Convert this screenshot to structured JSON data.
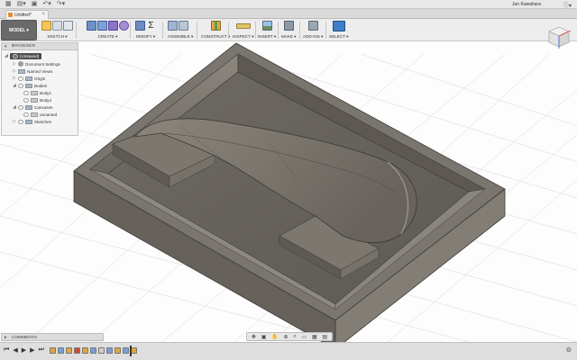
{
  "app": {
    "user_name": "Jun Kawahara",
    "help_icon": "help-icon",
    "menu_icons": [
      "grid-menu-icon",
      "file-icon",
      "save-icon",
      "undo-icon",
      "redo-icon"
    ]
  },
  "document": {
    "tab_title": "Untitled*"
  },
  "toolbar": {
    "workspace_label": "MODEL ▾",
    "groups": [
      {
        "label": "SKETCH ▾",
        "icons": [
          "sketch-icon",
          "line-icon",
          "rectangle-icon"
        ]
      },
      {
        "label": "CREATE ▾",
        "icons": [
          "box-icon",
          "extrude-icon",
          "revolve-icon",
          "sphere-icon"
        ]
      },
      {
        "label": "MODIFY ▾",
        "icons": [
          "press-pull-icon",
          "fillet-icon"
        ]
      },
      {
        "label": "ASSEMBLE ▾",
        "icons": [
          "component-icon",
          "joint-icon"
        ]
      },
      {
        "label": "CONSTRUCT ▾",
        "icons": [
          "plane-icon"
        ]
      },
      {
        "label": "INSPECT ▾",
        "icons": [
          "measure-icon"
        ]
      },
      {
        "label": "INSERT ▾",
        "icons": [
          "image-icon"
        ]
      },
      {
        "label": "MAKE ▾",
        "icons": [
          "3d-print-icon"
        ]
      },
      {
        "label": "ADD-INS ▾",
        "icons": [
          "scripts-icon"
        ]
      },
      {
        "label": "SELECT ▾",
        "icons": [
          "cursor-icon"
        ]
      }
    ]
  },
  "browser": {
    "title": "BROWSER",
    "root": "(Unsaved)",
    "nodes": [
      {
        "label": "Document Settings"
      },
      {
        "label": "Named Views"
      },
      {
        "label": "Origin"
      },
      {
        "label": "Bodies"
      },
      {
        "label": "Body1"
      },
      {
        "label": "Body4"
      },
      {
        "label": "Canvases"
      },
      {
        "label": "unnamed"
      },
      {
        "label": "Sketches"
      }
    ]
  },
  "comments": {
    "title": "COMMENTS"
  },
  "colors": {
    "model_top": "#757068",
    "model_side": "#5f5a53",
    "model_front": "#6d6860",
    "grid": "#d0d0d0",
    "workspace_button": "#6a6a6a"
  }
}
